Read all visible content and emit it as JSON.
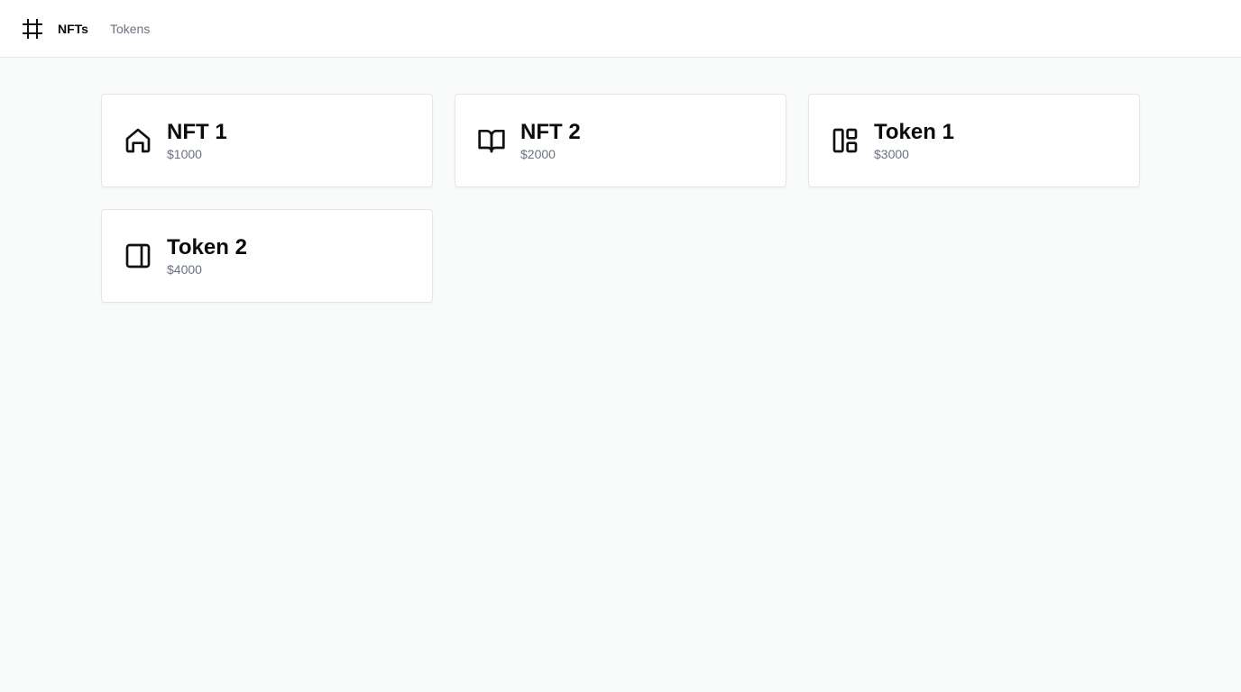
{
  "nav": {
    "logo_icon": "hash-icon",
    "items": [
      {
        "label": "NFTs",
        "active": true
      },
      {
        "label": "Tokens",
        "active": false
      }
    ]
  },
  "cards": [
    {
      "title": "NFT 1",
      "price": "$1000",
      "icon": "home-icon"
    },
    {
      "title": "NFT 2",
      "price": "$2000",
      "icon": "book-open-icon"
    },
    {
      "title": "Token 1",
      "price": "$3000",
      "icon": "layout-dashboard-icon"
    },
    {
      "title": "Token 2",
      "price": "$4000",
      "icon": "panel-right-icon"
    }
  ],
  "colors": {
    "background": "#f9fafa",
    "text_primary": "#0b0b0b",
    "text_muted": "#6b7280",
    "border": "#e3e5e7"
  }
}
